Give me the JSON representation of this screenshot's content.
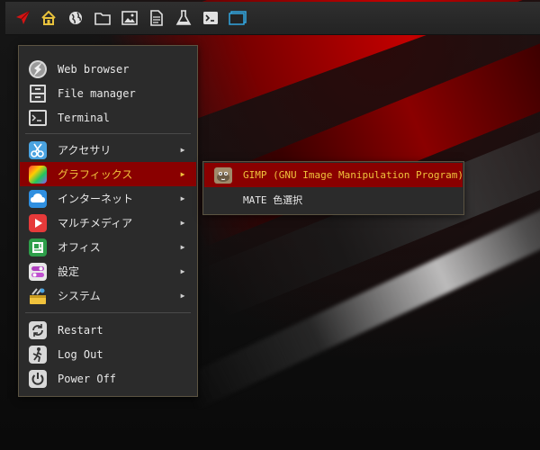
{
  "panel": {
    "launcher_icon": "rocket-icon",
    "icons": [
      {
        "name": "home-icon"
      },
      {
        "name": "globe-icon"
      },
      {
        "name": "folder-icon"
      },
      {
        "name": "image-icon"
      },
      {
        "name": "document-icon"
      },
      {
        "name": "flask-icon"
      },
      {
        "name": "terminal-icon"
      },
      {
        "name": "window-icon"
      }
    ]
  },
  "menu": {
    "favorites": [
      {
        "label": "Web browser",
        "icon": "web-browser-icon"
      },
      {
        "label": "File manager",
        "icon": "file-manager-icon"
      },
      {
        "label": "Terminal",
        "icon": "terminal-app-icon"
      }
    ],
    "categories": [
      {
        "label": "アクセサリ",
        "icon": "accessories-icon",
        "arrow": "▶"
      },
      {
        "label": "グラフィックス",
        "icon": "graphics-icon",
        "arrow": "▶"
      },
      {
        "label": "インターネット",
        "icon": "internet-icon",
        "arrow": "▶"
      },
      {
        "label": "マルチメディア",
        "icon": "multimedia-icon",
        "arrow": "▶"
      },
      {
        "label": "オフィス",
        "icon": "office-icon",
        "arrow": "▶"
      },
      {
        "label": "設定",
        "icon": "settings-icon",
        "arrow": "▶"
      },
      {
        "label": "システム",
        "icon": "system-icon",
        "arrow": "▶"
      }
    ],
    "session": [
      {
        "label": "Restart",
        "icon": "restart-icon"
      },
      {
        "label": "Log Out",
        "icon": "logout-icon"
      },
      {
        "label": "Power Off",
        "icon": "power-icon"
      }
    ],
    "active_category": "グラフィックス"
  },
  "submenu": {
    "items": [
      {
        "label": "GIMP (GNU Image Manipulation Program)",
        "icon": "gimp-icon"
      },
      {
        "label": "MATE 色選択",
        "icon": ""
      }
    ]
  },
  "colors": {
    "highlight": "#8a0000",
    "highlight_text": "#f0c23c",
    "menu_bg": "#2b2b2b",
    "menu_border": "#5c5442",
    "text": "#e8e8e8"
  }
}
